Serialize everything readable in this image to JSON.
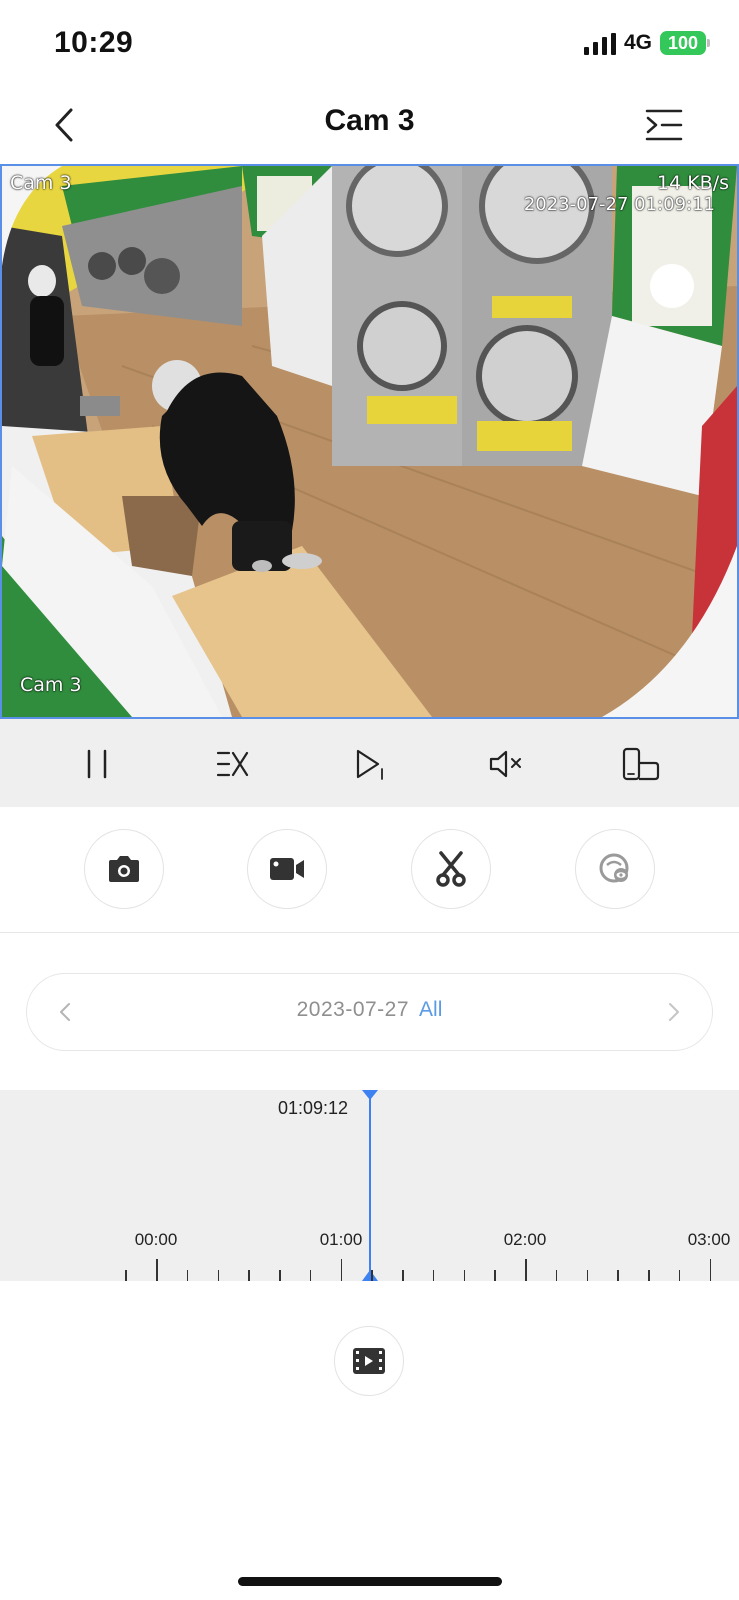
{
  "status_bar": {
    "time": "10:29",
    "network": "4G",
    "battery": "100",
    "battery_color": "#34c759"
  },
  "nav": {
    "title": "Cam 3",
    "back_icon": "chevron-left-icon",
    "menu_icon": "list-menu-icon"
  },
  "video": {
    "cam_label_top": "Cam 3",
    "cam_label_bottom": "Cam 3",
    "bitrate": "14 KB/s",
    "timestamp": "2023-07-27 01:09:11",
    "border_color": "#5a8fe8"
  },
  "controls": [
    {
      "name": "pause-icon"
    },
    {
      "name": "playback-speed-icon"
    },
    {
      "name": "play-next-icon"
    },
    {
      "name": "mute-icon"
    },
    {
      "name": "landscape-rotate-icon"
    }
  ],
  "actions": [
    {
      "name": "snapshot-camera-icon"
    },
    {
      "name": "record-video-icon"
    },
    {
      "name": "clip-scissors-icon"
    },
    {
      "name": "face-detect-icon"
    }
  ],
  "date_selector": {
    "date": "2023-07-27",
    "filter": "All",
    "filter_color": "#5a9ae6"
  },
  "timeline": {
    "current_time": "01:09:12",
    "hours": [
      "00:00",
      "01:00",
      "02:00",
      "03:00"
    ],
    "accent": "#3d82f0"
  },
  "clips_button_icon": "film-strip-icon"
}
